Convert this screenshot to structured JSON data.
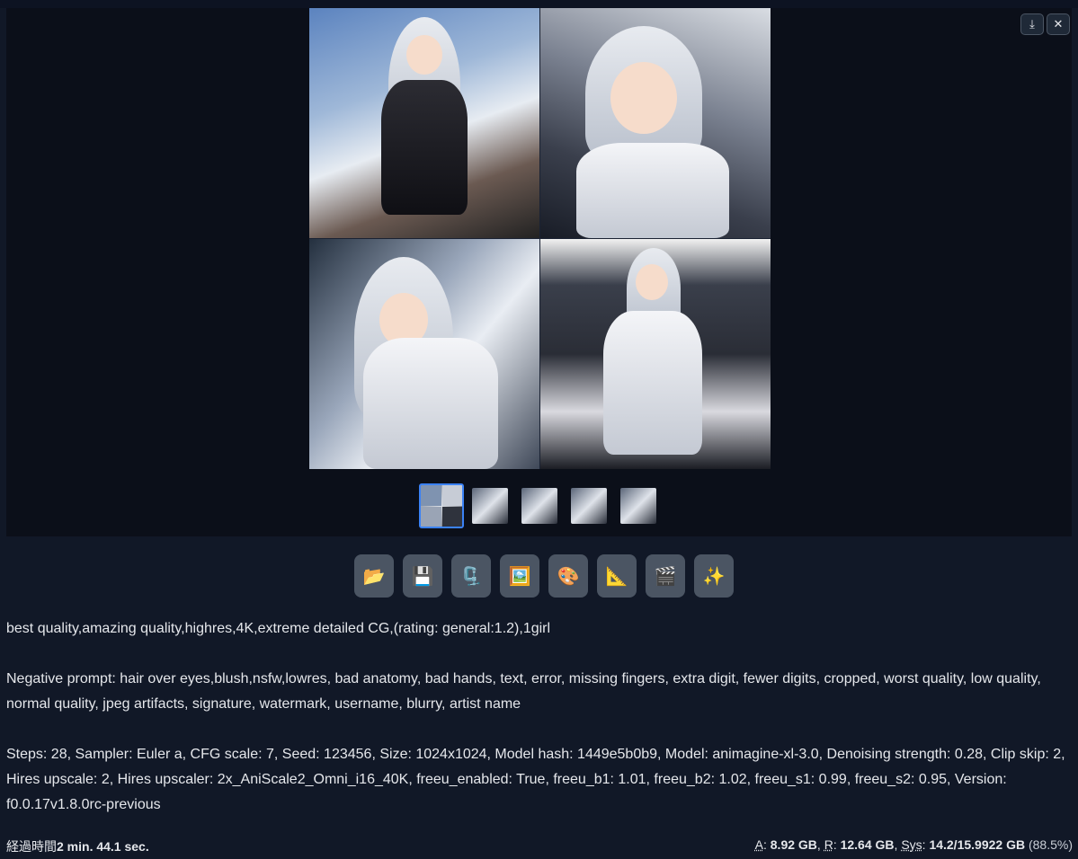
{
  "gallery": {
    "toolbar_icons": [
      "download-icon",
      "close-icon"
    ],
    "download_glyph": "⤓",
    "close_glyph": "✕",
    "selected_thumbnail": 1,
    "thumbnail_count": 5
  },
  "actions": [
    {
      "name": "open-folder-button",
      "icon": "📂"
    },
    {
      "name": "save-button",
      "icon": "💾"
    },
    {
      "name": "zip-button",
      "icon": "🗜️"
    },
    {
      "name": "send-to-img2img-button",
      "icon": "🖼️"
    },
    {
      "name": "send-to-inpaint-button",
      "icon": "🎨"
    },
    {
      "name": "send-to-extras-button",
      "icon": "📐"
    },
    {
      "name": "send-to-video-button",
      "icon": "🎬"
    },
    {
      "name": "send-to-enhance-button",
      "icon": "✨"
    }
  ],
  "generation_info": {
    "prompt": "best quality,amazing quality,highres,4K,extreme detailed CG,(rating: general:1.2),1girl",
    "negative_prompt": "Negative prompt: hair over eyes,blush,nsfw,lowres, bad anatomy, bad hands, text, error, missing fingers, extra digit, fewer digits, cropped, worst quality, low quality, normal quality, jpeg artifacts, signature, watermark, username, blurry, artist name",
    "parameters": "Steps: 28, Sampler: Euler a, CFG scale: 7, Seed: 123456, Size: 1024x1024, Model hash: 1449e5b0b9, Model: animagine-xl-3.0, Denoising strength: 0.28, Clip skip: 2, Hires upscale: 2, Hires upscaler: 2x_AniScale2_Omni_i16_40K, freeu_enabled: True, freeu_b1: 1.01, freeu_b2: 1.02, freeu_s1: 0.99, freeu_s2: 0.95, Version: f0.0.17v1.8.0rc-previous"
  },
  "footer": {
    "elapsed_label": "経過時間",
    "elapsed_value": "2 min. 44.1 sec.",
    "a_label": "A",
    "a_value": "8.92 GB",
    "r_label": "R",
    "r_value": "12.64 GB",
    "sys_label": "Sys",
    "sys_value": "14.2/15.9922 GB",
    "sys_percent": "(88.5%)"
  }
}
